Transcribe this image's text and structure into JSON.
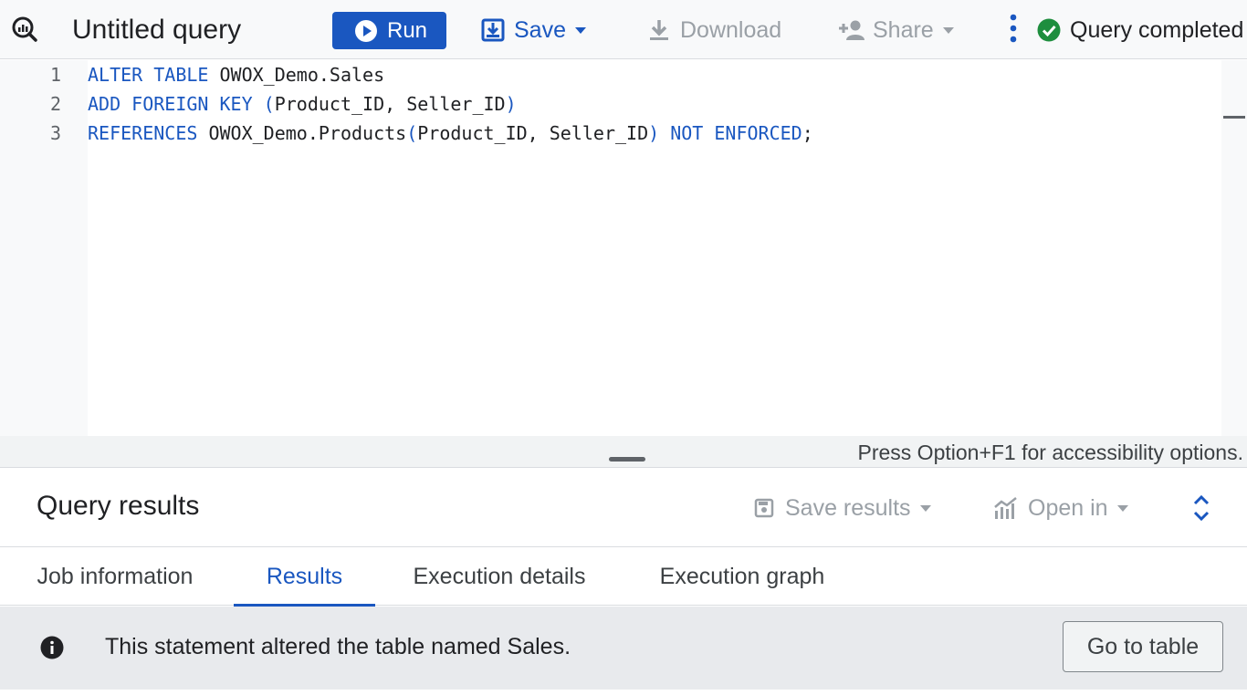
{
  "toolbar": {
    "title": "Untitled query",
    "run_label": "Run",
    "save_label": "Save",
    "download_label": "Download",
    "share_label": "Share",
    "status_label": "Query completed"
  },
  "editor": {
    "line_numbers": [
      "1",
      "2",
      "3"
    ],
    "lines": [
      [
        {
          "t": "ALTER TABLE",
          "k": true
        },
        {
          "t": " OWOX_Demo.Sales",
          "k": false
        }
      ],
      [
        {
          "t": "ADD FOREIGN KEY (",
          "k": true
        },
        {
          "t": "Product_ID, Seller_ID",
          "k": false
        },
        {
          "t": ")",
          "k": true
        }
      ],
      [
        {
          "t": "REFERENCES",
          "k": true
        },
        {
          "t": " OWOX_Demo.Products",
          "k": false
        },
        {
          "t": "(",
          "k": true
        },
        {
          "t": "Product_ID, Seller_ID",
          "k": false
        },
        {
          "t": ") NOT ENFORCED",
          "k": true
        },
        {
          "t": ";",
          "k": false
        }
      ]
    ],
    "accessibility_hint": "Press Option+F1 for accessibility options."
  },
  "results": {
    "title": "Query results",
    "save_results_label": "Save results",
    "open_in_label": "Open in"
  },
  "tabs": [
    {
      "label": "Job information",
      "active": false
    },
    {
      "label": "Results",
      "active": true
    },
    {
      "label": "Execution details",
      "active": false
    },
    {
      "label": "Execution graph",
      "active": false
    }
  ],
  "banner": {
    "message": "This statement altered the table named Sales.",
    "button_label": "Go to table"
  },
  "colors": {
    "accent": "#1a57c0",
    "success": "#1e8e3e",
    "disabled": "#9aa0a6"
  }
}
